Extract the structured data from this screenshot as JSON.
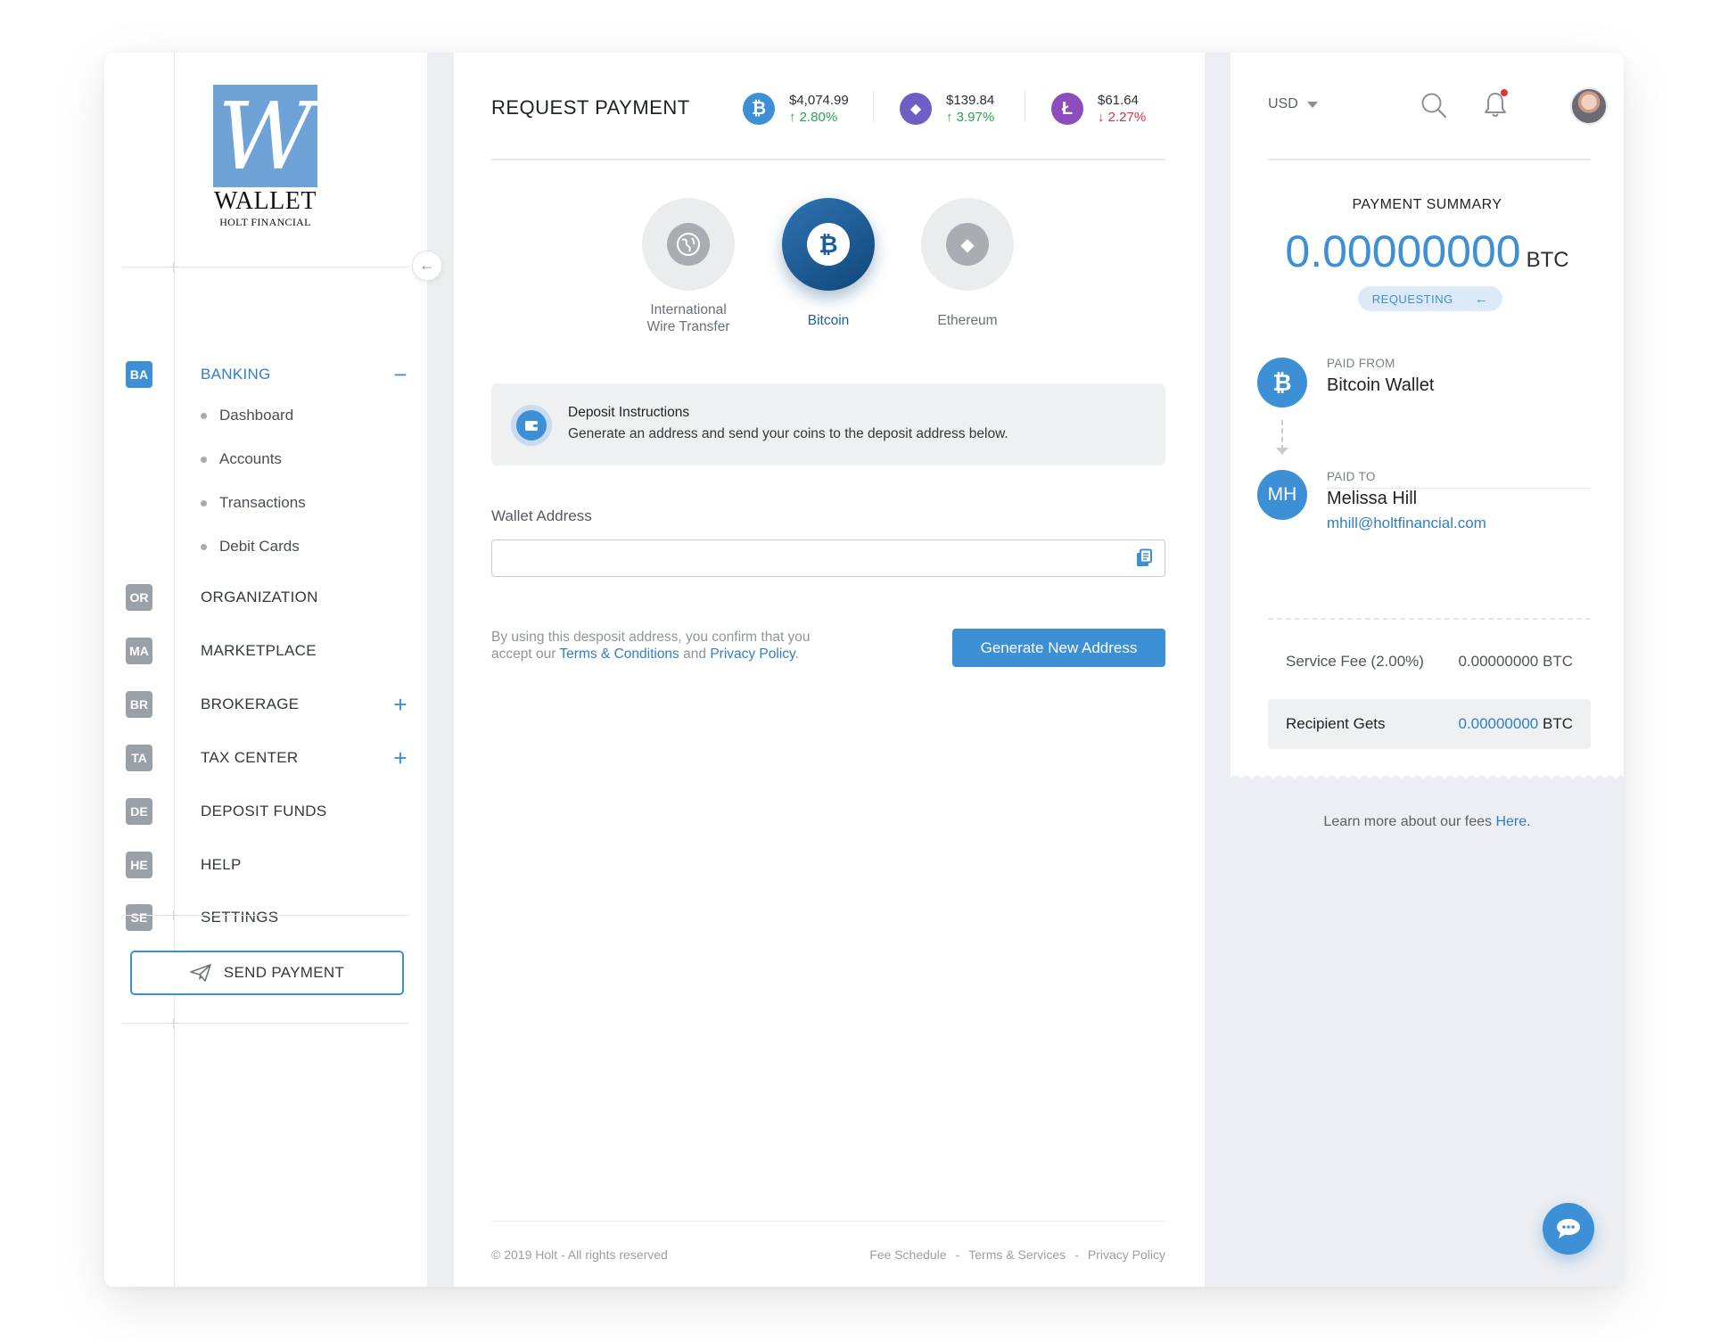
{
  "brand": {
    "logo_letter": "W",
    "name": "WALLET",
    "subtitle": "HOLT FINANCIAL",
    "color": "#6fa3d8"
  },
  "accent_color": "#3d8fd6",
  "sidebar": {
    "items": [
      {
        "badge": "BA",
        "label": "BANKING",
        "active": true,
        "toggle": "−"
      },
      {
        "badge": "OR",
        "label": "ORGANIZATION"
      },
      {
        "badge": "MA",
        "label": "MARKETPLACE"
      },
      {
        "badge": "BR",
        "label": "BROKERAGE",
        "toggle": "+"
      },
      {
        "badge": "TA",
        "label": "TAX CENTER",
        "toggle": "+"
      },
      {
        "badge": "DE",
        "label": "DEPOSIT FUNDS"
      },
      {
        "badge": "HE",
        "label": "HELP"
      },
      {
        "badge": "SE",
        "label": "SETTINGS"
      }
    ],
    "banking_subitems": [
      "Dashboard",
      "Accounts",
      "Transactions",
      "Debit Cards"
    ],
    "send_payment_label": "SEND PAYMENT",
    "collapse_icon": "arrow-left-icon"
  },
  "header": {
    "title": "REQUEST PAYMENT",
    "tickers": [
      {
        "icon": "bitcoin-icon",
        "symbol": "₿",
        "price": "$4,074.99",
        "change": "↑ 2.80%",
        "direction": "up",
        "color": "#3d8fd6"
      },
      {
        "icon": "ethereum-icon",
        "symbol": "◆",
        "price": "$139.84",
        "change": "↑ 3.97%",
        "direction": "up",
        "color": "#6f5fc4"
      },
      {
        "icon": "litecoin-icon",
        "symbol": "Ł",
        "price": "$61.64",
        "change": "↓ 2.27%",
        "direction": "down",
        "color": "#8e4dbd"
      }
    ]
  },
  "methods": [
    {
      "label": "International Wire Transfer",
      "icon": "globe-icon",
      "symbol": "●"
    },
    {
      "label": "Bitcoin",
      "icon": "bitcoin-icon",
      "symbol": "₿",
      "active": true
    },
    {
      "label": "Ethereum",
      "icon": "ethereum-icon",
      "symbol": "◆"
    }
  ],
  "deposit": {
    "title": "Deposit Instructions",
    "text": "Generate an address and send your coins to the deposit address below."
  },
  "wallet_address": {
    "label": "Wallet Address",
    "value": "",
    "placeholder": ""
  },
  "consent": {
    "prefix": "By using this desposit address, you confirm that you accept our",
    "terms": "Terms & Conditions",
    "and": "and",
    "privacy": "Privacy Policy",
    "suffix": "."
  },
  "generate_button_label": "Generate New Address",
  "footer": {
    "copyright": "© 2019 Holt - All rights reserved",
    "links": [
      "Fee Schedule",
      "Terms & Services",
      "Privacy Policy"
    ],
    "separator": "-"
  },
  "summary_panel": {
    "currency": "USD",
    "title": "PAYMENT SUMMARY",
    "amount": "0.00000000",
    "unit": "BTC",
    "status": "REQUESTING",
    "paid_from_label": "PAID FROM",
    "paid_from_name": "Bitcoin Wallet",
    "paid_from_symbol": "₿",
    "paid_to_label": "PAID TO",
    "paid_to_initials": "MH",
    "paid_to_name": "Melissa Hill",
    "paid_to_email": "mhill@holtfinancial.com",
    "fees": [
      {
        "label": "Service Fee (2.00%)",
        "value": "0.00000000",
        "unit": "BTC"
      },
      {
        "label": "Recipient Gets",
        "value": "0.00000000",
        "unit": "BTC"
      }
    ],
    "learn_prefix": "Learn more about our fees",
    "learn_link": "Here",
    "learn_suffix": "."
  }
}
